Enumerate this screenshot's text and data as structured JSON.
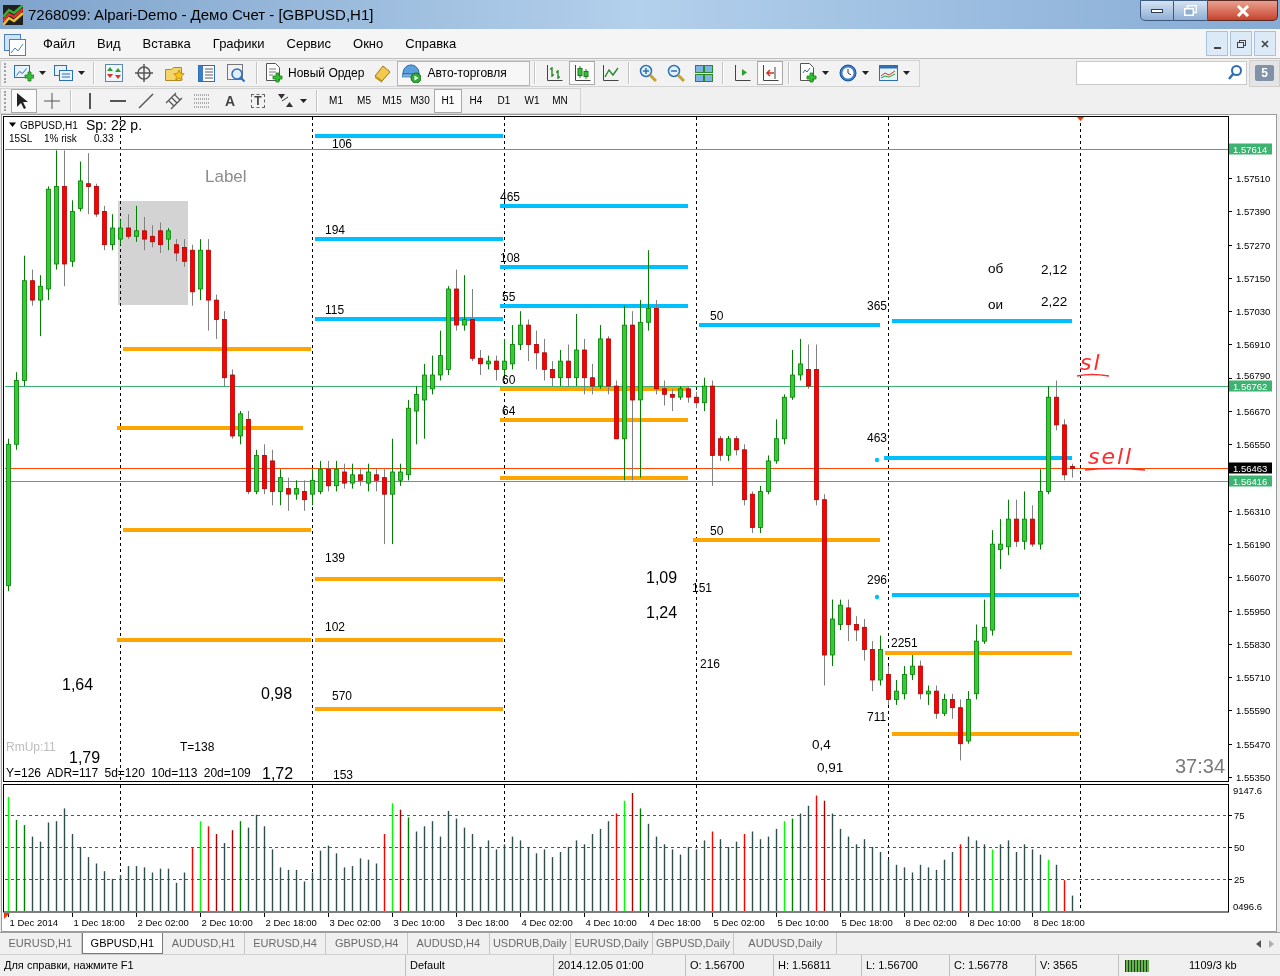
{
  "window": {
    "title": "7268099: Alpari-Demo - Демо Счет - [GBPUSD,H1]"
  },
  "menu": [
    "Файл",
    "Вид",
    "Вставка",
    "Графики",
    "Сервис",
    "Окно",
    "Справка"
  ],
  "toolbar": {
    "new_order": "Новый Ордер",
    "auto_trading": {
      "label": "Авто-торговля",
      "on": true
    },
    "chart_types": [
      {
        "selected": false
      },
      {
        "selected": true
      },
      {
        "selected": false
      }
    ],
    "view_toggles": [
      {
        "selected": false
      },
      {
        "selected": true
      }
    ],
    "notifications": "5"
  },
  "drawing_toolbar": {
    "tools": [
      {
        "selected": true
      },
      {
        "selected": false
      },
      {
        "selected": false
      },
      {
        "selected": false
      },
      {
        "selected": false
      },
      {
        "selected": false
      },
      {
        "selected": false
      },
      {
        "glyph": "A",
        "selected": false
      },
      {
        "glyph": "T",
        "selected": false
      },
      {
        "selected": false
      }
    ],
    "periods": [
      {
        "label": "M1",
        "selected": false
      },
      {
        "label": "M5",
        "selected": false
      },
      {
        "label": "M15",
        "selected": false
      },
      {
        "label": "M30",
        "selected": false
      },
      {
        "label": "H1",
        "selected": true
      },
      {
        "label": "H4",
        "selected": false
      },
      {
        "label": "D1",
        "selected": false
      },
      {
        "label": "W1",
        "selected": false
      },
      {
        "label": "MN",
        "selected": false
      }
    ]
  },
  "chart": {
    "symbol": "GBPUSD,H1",
    "spread": "Sp: 22 p.",
    "stop_loss": "15SL",
    "risk": "1% risk",
    "lot": "0.33",
    "chart_data": [
      {
        "type": "candlestick",
        "categories": [
          null,
          null,
          null,
          null,
          null,
          null,
          null,
          null,
          null,
          null,
          null,
          null,
          null,
          null,
          null,
          null,
          null,
          null,
          null,
          null,
          null,
          null,
          null,
          null,
          null,
          null,
          null,
          null,
          null,
          null,
          null,
          null,
          null,
          null,
          null,
          null,
          null,
          null,
          null,
          null,
          null,
          null,
          null,
          null,
          null,
          null,
          null,
          null,
          null,
          null,
          null,
          null,
          null,
          null,
          null,
          null,
          null,
          null,
          null,
          null,
          null,
          null,
          null,
          null,
          null,
          null,
          null,
          null,
          null,
          null,
          null,
          null,
          null,
          null,
          null,
          null,
          null,
          null,
          null,
          null,
          null,
          null,
          null,
          null,
          null,
          null,
          null,
          null,
          null,
          null,
          null,
          null,
          null,
          null,
          null,
          null,
          null,
          null,
          null,
          null,
          null,
          null,
          null,
          null,
          null,
          null,
          null,
          null,
          null,
          null,
          null,
          null,
          null,
          null,
          null,
          null,
          null,
          null,
          null,
          null,
          null,
          null,
          null,
          null,
          null,
          null,
          null,
          null,
          null,
          null,
          null,
          null,
          null,
          null,
          null,
          null,
          null,
          null,
          null,
          null,
          null,
          null,
          null,
          null,
          null,
          null,
          null,
          null,
          null,
          null,
          null,
          null,
          null
        ],
        "ohlc": [
          [
            1.5604,
            1.5657,
            1.5602,
            1.5655
          ],
          [
            1.5655,
            1.5681,
            1.5653,
            1.5678
          ],
          [
            1.5678,
            1.5723,
            1.5676,
            1.5714
          ],
          [
            1.5714,
            1.5718,
            1.5705,
            1.5707
          ],
          [
            1.5707,
            1.5716,
            1.5694,
            1.5712
          ],
          [
            1.5711,
            1.5748,
            1.5707,
            1.5747
          ],
          [
            1.572,
            1.5761,
            1.5718,
            1.5748
          ],
          [
            1.5748,
            1.5761,
            1.5712,
            1.572
          ],
          [
            1.5721,
            1.5743,
            1.5719,
            1.5739
          ],
          [
            1.574,
            1.5757,
            1.5739,
            1.575
          ],
          [
            1.5749,
            1.576,
            1.5738,
            1.5748
          ],
          [
            1.5748,
            1.5749,
            1.5737,
            1.5738
          ],
          [
            1.5739,
            1.5741,
            1.5725,
            1.5727
          ],
          [
            1.5727,
            1.5738,
            1.5725,
            1.5733
          ],
          [
            1.5729,
            1.5736,
            1.5727,
            1.5733
          ],
          [
            1.5733,
            1.5738,
            1.5729,
            1.573
          ],
          [
            1.573,
            1.5741,
            1.5728,
            1.5732
          ],
          [
            1.5732,
            1.5737,
            1.5725,
            1.5729
          ],
          [
            1.573,
            1.5734,
            1.5726,
            1.5728
          ],
          [
            1.5732,
            1.5735,
            1.5724,
            1.5727
          ],
          [
            1.5729,
            1.5733,
            1.5725,
            1.5732
          ],
          [
            1.5727,
            1.5729,
            1.5721,
            1.5724
          ],
          [
            1.5726,
            1.5729,
            1.5719,
            1.5721
          ],
          [
            1.5725,
            1.5727,
            1.5705,
            1.571
          ],
          [
            1.5711,
            1.5729,
            1.5707,
            1.5725
          ],
          [
            1.5725,
            1.5729,
            1.5696,
            1.5707
          ],
          [
            1.5707,
            1.5709,
            1.5693,
            1.57
          ],
          [
            1.57,
            1.5703,
            1.5676,
            1.5679
          ],
          [
            1.568,
            1.5682,
            1.5657,
            1.5658
          ],
          [
            1.5658,
            1.5667,
            1.5655,
            1.5666
          ],
          [
            1.5664,
            1.5667,
            1.5637,
            1.5638
          ],
          [
            1.5638,
            1.5653,
            1.5637,
            1.5651
          ],
          [
            1.5651,
            1.5655,
            1.5637,
            1.5639
          ],
          [
            1.5649,
            1.5653,
            1.5633,
            1.5638
          ],
          [
            1.5638,
            1.5646,
            1.5633,
            1.5643
          ],
          [
            1.5639,
            1.5643,
            1.5631,
            1.5637
          ],
          [
            1.5637,
            1.5642,
            1.5635,
            1.5639
          ],
          [
            1.5638,
            1.5642,
            1.5631,
            1.5635
          ],
          [
            1.5637,
            1.5646,
            1.5633,
            1.5642
          ],
          [
            1.5638,
            1.5649,
            1.5637,
            1.5646
          ],
          [
            1.5646,
            1.5649,
            1.5638,
            1.564
          ],
          [
            1.564,
            1.5649,
            1.5638,
            1.5646
          ],
          [
            1.5645,
            1.5648,
            1.5639,
            1.5641
          ],
          [
            1.5641,
            1.5648,
            1.5639,
            1.5644
          ],
          [
            1.5644,
            1.5646,
            1.564,
            1.5642
          ],
          [
            1.5641,
            1.5648,
            1.5638,
            1.5645
          ],
          [
            1.5644,
            1.5646,
            1.5638,
            1.5642
          ],
          [
            1.5643,
            1.5646,
            1.5619,
            1.5637
          ],
          [
            1.5637,
            1.5657,
            1.5619,
            1.5645
          ],
          [
            1.5642,
            1.5648,
            1.564,
            1.5645
          ],
          [
            1.5644,
            1.5671,
            1.5642,
            1.5668
          ],
          [
            1.5667,
            1.5676,
            1.5655,
            1.5673
          ],
          [
            1.5671,
            1.5684,
            1.5657,
            1.568
          ],
          [
            1.5675,
            1.5687,
            1.5673,
            1.568
          ],
          [
            1.568,
            1.5696,
            1.5678,
            1.5687
          ],
          [
            1.5682,
            1.5712,
            1.568,
            1.5711
          ],
          [
            1.5711,
            1.5718,
            1.5696,
            1.5698
          ],
          [
            1.5698,
            1.5716,
            1.5696,
            1.57
          ],
          [
            1.57,
            1.5711,
            1.5685,
            1.5686
          ],
          [
            1.5686,
            1.5689,
            1.568,
            1.5684
          ],
          [
            1.5684,
            1.5687,
            1.5682,
            1.5685
          ],
          [
            1.5685,
            1.5687,
            1.5678,
            1.5682
          ],
          [
            1.5682,
            1.5693,
            1.568,
            1.5685
          ],
          [
            1.5684,
            1.5698,
            1.5682,
            1.5691
          ],
          [
            1.5691,
            1.5703,
            1.5689,
            1.5698
          ],
          [
            1.5698,
            1.57,
            1.5685,
            1.5691
          ],
          [
            1.5691,
            1.5696,
            1.5682,
            1.5688
          ],
          [
            1.5688,
            1.5693,
            1.5678,
            1.5682
          ],
          [
            1.5682,
            1.5685,
            1.5676,
            1.5679
          ],
          [
            1.5679,
            1.5689,
            1.5676,
            1.5685
          ],
          [
            1.5685,
            1.5691,
            1.5676,
            1.5679
          ],
          [
            1.5679,
            1.5702,
            1.5676,
            1.5689
          ],
          [
            1.5689,
            1.5693,
            1.5673,
            1.5679
          ],
          [
            1.5679,
            1.5684,
            1.5673,
            1.5676
          ],
          [
            1.5676,
            1.5698,
            1.5675,
            1.5693
          ],
          [
            1.5693,
            1.5694,
            1.5673,
            1.5676
          ],
          [
            1.5676,
            1.5678,
            1.5657,
            1.5657
          ],
          [
            1.5657,
            1.5705,
            1.5642,
            1.5698
          ],
          [
            1.5698,
            1.5703,
            1.5642,
            1.5671
          ],
          [
            1.5671,
            1.5707,
            1.5643,
            1.5699
          ],
          [
            1.5699,
            1.5725,
            1.5696,
            1.5704
          ],
          [
            1.5704,
            1.5707,
            1.5673,
            1.5675
          ],
          [
            1.5675,
            1.5678,
            1.5669,
            1.5673
          ],
          [
            1.5673,
            1.5675,
            1.5667,
            1.5672
          ],
          [
            1.5672,
            1.5676,
            1.5671,
            1.5675
          ],
          [
            1.5675,
            1.5676,
            1.567,
            1.5672
          ],
          [
            1.5672,
            1.5674,
            1.5668,
            1.567
          ],
          [
            1.567,
            1.5679,
            1.5667,
            1.5676
          ],
          [
            1.5676,
            1.5678,
            1.564,
            1.5651
          ],
          [
            1.5657,
            1.5658,
            1.5649,
            1.5651
          ],
          [
            1.5651,
            1.5658,
            1.5649,
            1.5657
          ],
          [
            1.5657,
            1.5658,
            1.5651,
            1.5653
          ],
          [
            1.5653,
            1.5655,
            1.5633,
            1.5635
          ],
          [
            1.5637,
            1.5638,
            1.5623,
            1.5625
          ],
          [
            1.5625,
            1.564,
            1.5623,
            1.5638
          ],
          [
            1.5638,
            1.5651,
            1.5637,
            1.5649
          ],
          [
            1.5649,
            1.5664,
            1.5648,
            1.5657
          ],
          [
            1.5657,
            1.5673,
            1.5655,
            1.5672
          ],
          [
            1.5672,
            1.5689,
            1.5671,
            1.568
          ],
          [
            1.568,
            1.5693,
            1.5678,
            1.5684
          ],
          [
            1.5682,
            1.5691,
            1.5675,
            1.5676
          ],
          [
            1.5682,
            1.5691,
            1.5633,
            1.5635
          ],
          [
            1.5635,
            1.5637,
            1.5568,
            1.5579
          ],
          [
            1.5579,
            1.5599,
            1.5575,
            1.5592
          ],
          [
            1.559,
            1.5599,
            1.5588,
            1.5597
          ],
          [
            1.5596,
            1.5599,
            1.5584,
            1.559
          ],
          [
            1.559,
            1.5593,
            1.5584,
            1.5588
          ],
          [
            1.5589,
            1.5592,
            1.5577,
            1.5581
          ],
          [
            1.5581,
            1.5584,
            1.5566,
            1.557
          ],
          [
            1.557,
            1.5586,
            1.5568,
            1.5581
          ],
          [
            1.5572,
            1.5575,
            1.5561,
            1.5563
          ],
          [
            1.5563,
            1.557,
            1.5561,
            1.5566
          ],
          [
            1.5565,
            1.5575,
            1.5563,
            1.5572
          ],
          [
            1.5572,
            1.5579,
            1.557,
            1.5575
          ],
          [
            1.5575,
            1.5577,
            1.5563,
            1.5565
          ],
          [
            1.5565,
            1.5568,
            1.5561,
            1.5566
          ],
          [
            1.5566,
            1.5568,
            1.5556,
            1.5558
          ],
          [
            1.5558,
            1.5565,
            1.5557,
            1.5563
          ],
          [
            1.5563,
            1.5565,
            1.5556,
            1.556
          ],
          [
            1.556,
            1.5563,
            1.5541,
            1.5547
          ],
          [
            1.5548,
            1.5566,
            1.5547,
            1.5563
          ],
          [
            1.5565,
            1.559,
            1.5563,
            1.5584
          ],
          [
            1.5584,
            1.5599,
            1.5583,
            1.5589
          ],
          [
            1.5588,
            1.5624,
            1.5586,
            1.5619
          ],
          [
            1.5617,
            1.5628,
            1.561,
            1.5619
          ],
          [
            1.5618,
            1.5635,
            1.5615,
            1.5628
          ],
          [
            1.5628,
            1.5635,
            1.5618,
            1.562
          ],
          [
            1.562,
            1.5638,
            1.5617,
            1.5628
          ],
          [
            1.5628,
            1.5633,
            1.5618,
            1.5619
          ],
          [
            1.5619,
            1.5646,
            1.5617,
            1.5638
          ],
          [
            1.5638,
            1.5676,
            1.5637,
            1.5672
          ],
          [
            1.5672,
            1.5678,
            1.566,
            1.5662
          ],
          [
            1.5662,
            1.5664,
            1.5642,
            1.5644
          ],
          [
            1.5647,
            1.5648,
            1.5643,
            1.56463
          ],
          null,
          null,
          null,
          null,
          null,
          null,
          null,
          null,
          null,
          null,
          null,
          null,
          null,
          null,
          null,
          null,
          null,
          null,
          null
        ],
        "ylim": [
          1.55332,
          1.57734
        ],
        "yticks": [
          {
            "value": 1.5535,
            "label": "1.55350"
          },
          {
            "value": 1.5547,
            "label": "1.55470"
          },
          {
            "value": 1.5559,
            "label": "1.55590"
          },
          {
            "value": 1.5571,
            "label": "1.55710"
          },
          {
            "value": 1.5583,
            "label": "1.55830"
          },
          {
            "value": 1.5595,
            "label": "1.55950"
          },
          {
            "value": 1.5607,
            "label": "1.56070"
          },
          {
            "value": 1.5619,
            "label": "1.56190"
          },
          {
            "value": 1.5631,
            "label": "1.56310"
          },
          {
            "value": 1.5655,
            "label": "1.56550"
          },
          {
            "value": 1.5667,
            "label": "1.56670"
          },
          {
            "value": 1.5679,
            "label": "1.56790"
          },
          {
            "value": 1.5691,
            "label": "1.56910"
          },
          {
            "value": 1.5703,
            "label": "1.57030"
          },
          {
            "value": 1.5715,
            "label": "1.57150"
          },
          {
            "value": 1.5727,
            "label": "1.57270"
          },
          {
            "value": 1.5739,
            "label": "1.57390"
          },
          {
            "value": 1.5751,
            "label": "1.57510"
          }
        ],
        "ref_lines": [
          {
            "axis": "y",
            "value": 1.57614,
            "label": "1.57614",
            "color": "#3cb371"
          },
          {
            "axis": "y",
            "value": 1.56762,
            "label": "1.56762",
            "color": "#3cb371"
          },
          {
            "axis": "y",
            "value": 1.56463,
            "label": "1.56463",
            "color": "#ff4500"
          },
          {
            "axis": "y",
            "value": 1.56416,
            "label": "1.56416",
            "color": "#3cb371"
          }
        ]
      },
      {
        "type": "bar",
        "values": [
          89,
          71,
          67,
          58,
          54,
          69,
          70,
          80,
          60,
          50,
          42,
          37,
          31,
          25,
          28,
          35,
          35,
          34,
          30,
          33,
          33,
          22,
          30,
          49,
          70,
          66,
          60,
          53,
          63,
          70,
          65,
          75,
          66,
          48,
          34,
          32,
          32,
          23,
          30,
          47,
          51,
          45,
          34,
          35,
          41,
          40,
          37,
          60,
          84,
          79,
          73,
          62,
          66,
          70,
          58,
          78,
          72,
          65,
          60,
          50,
          55,
          48,
          52,
          58,
          55,
          50,
          45,
          48,
          42,
          46,
          50,
          55,
          52,
          60,
          64,
          70,
          76,
          86,
          92,
          80,
          68,
          58,
          52,
          48,
          44,
          50,
          48,
          55,
          62,
          56,
          50,
          54,
          60,
          62,
          56,
          58,
          64,
          70,
          72,
          76,
          82,
          90,
          86,
          76,
          64,
          58,
          52,
          56,
          50,
          46,
          40,
          36,
          34,
          30,
          36,
          34,
          32,
          40,
          46,
          52,
          58,
          55,
          52,
          48,
          52,
          55,
          46,
          52,
          48,
          44,
          40,
          36,
          24,
          12,
          null,
          null,
          null,
          null,
          null,
          null,
          null,
          null,
          null,
          null,
          null,
          null,
          null,
          null,
          null,
          null,
          null,
          null,
          null
        ],
        "colors": [
          "#00ff00",
          "#008000",
          "#008000",
          "#2f4f4f",
          "#2f4f4f",
          "#2f4f4f",
          "#2f4f4f",
          "#2f4f4f",
          "#2f4f4f",
          "#2f4f4f",
          "#2f4f4f",
          "#2f4f4f",
          "#2f4f4f",
          "#2f4f4f",
          "#2f4f4f",
          "#2f4f4f",
          "#2f4f4f",
          "#2f4f4f",
          "#2f4f4f",
          "#2f4f4f",
          "#2f4f4f",
          "#2f4f4f",
          "#2f4f4f",
          "#ff0000",
          "#00ff00",
          "#ff0000",
          "#b00000",
          "#2f4f4f",
          "#b00000",
          "#008000",
          "#2f4f4f",
          "#2f4f4f",
          "#2f4f4f",
          "#2f4f4f",
          "#2f4f4f",
          "#2f4f4f",
          "#2f4f4f",
          "#2f4f4f",
          "#2f4f4f",
          "#2f4f4f",
          "#2f4f4f",
          "#2f4f4f",
          "#2f4f4f",
          "#2f4f4f",
          "#2f4f4f",
          "#2f4f4f",
          "#2f4f4f",
          "#ff0000",
          "#00ff00",
          "#b00000",
          "#008000",
          "#2f4f4f",
          "#2f4f4f",
          "#2f4f4f",
          "#2f4f4f",
          "#2f4f4f",
          "#2f4f4f",
          "#2f4f4f",
          "#2f4f4f",
          "#2f4f4f",
          "#2f4f4f",
          "#2f4f4f",
          "#2f4f4f",
          "#2f4f4f",
          "#2f4f4f",
          "#2f4f4f",
          "#2f4f4f",
          "#2f4f4f",
          "#2f4f4f",
          "#2f4f4f",
          "#2f4f4f",
          "#2f4f4f",
          "#2f4f4f",
          "#2f4f4f",
          "#2f4f4f",
          "#2f4f4f",
          "#ff0000",
          "#00ff00",
          "#b00000",
          "#008000",
          "#2f4f4f",
          "#2f4f4f",
          "#2f4f4f",
          "#2f4f4f",
          "#2f4f4f",
          "#2f4f4f",
          "#2f4f4f",
          "#2f4f4f",
          "#ff0000",
          "#2f4f4f",
          "#2f4f4f",
          "#2f4f4f",
          "#ff0000",
          "#2f4f4f",
          "#2f4f4f",
          "#2f4f4f",
          "#2f4f4f",
          "#00ff00",
          "#008000",
          "#2f4f4f",
          "#2f4f4f",
          "#ff0000",
          "#b00000",
          "#2f4f4f",
          "#2f4f4f",
          "#2f4f4f",
          "#2f4f4f",
          "#2f4f4f",
          "#2f4f4f",
          "#2f4f4f",
          "#2f4f4f",
          "#2f4f4f",
          "#2f4f4f",
          "#2f4f4f",
          "#2f4f4f",
          "#2f4f4f",
          "#2f4f4f",
          "#2f4f4f",
          "#2f4f4f",
          "#ff0000",
          "#2f4f4f",
          "#2f4f4f",
          "#2f4f4f",
          "#00ff00",
          "#2f4f4f",
          "#2f4f4f",
          "#2f4f4f",
          "#2f4f4f",
          "#2f4f4f",
          "#2f4f4f",
          "#00ff00",
          "#2f4f4f",
          "#ff0000",
          "#2f4f4f",
          null,
          null,
          null,
          null,
          null,
          null,
          null,
          null,
          null,
          null,
          null,
          null,
          null,
          null,
          null,
          null,
          null,
          null,
          null
        ],
        "ylim": [
          0,
          99
        ],
        "yticks": [
          25,
          50,
          75
        ],
        "grid": true
      }
    ],
    "time_axis": [
      "1 Dec 2014",
      "1 Dec 18:00",
      "2 Dec 02:00",
      "2 Dec 10:00",
      "2 Dec 18:00",
      "3 Dec 02:00",
      "3 Dec 10:00",
      "3 Dec 18:00",
      "4 Dec 02:00",
      "4 Dec 10:00",
      "4 Dec 18:00",
      "5 Dec 02:00",
      "5 Dec 10:00",
      "5 Dec 18:00",
      "8 Dec 02:00",
      "8 Dec 10:00",
      "8 Dec 18:00"
    ],
    "indicator_scale": [
      "9147.6",
      "0496.6"
    ],
    "texts": [
      {
        "text": "Label",
        "kind": "label"
      },
      {
        "text": "106",
        "kind": "level"
      },
      {
        "text": "465",
        "kind": "level"
      },
      {
        "text": "194",
        "kind": "level"
      },
      {
        "text": "108",
        "kind": "level"
      },
      {
        "text": "об",
        "kind": "note"
      },
      {
        "text": "2,12",
        "kind": "note"
      },
      {
        "text": "ои",
        "kind": "note"
      },
      {
        "text": "2,22",
        "kind": "note"
      },
      {
        "text": "55",
        "kind": "level"
      },
      {
        "text": "365",
        "kind": "level"
      },
      {
        "text": "115",
        "kind": "level"
      },
      {
        "text": "50",
        "kind": "level"
      },
      {
        "text": "sl",
        "kind": "handwritten"
      },
      {
        "text": "60",
        "kind": "level"
      },
      {
        "text": "64",
        "kind": "level"
      },
      {
        "text": "463",
        "kind": "level"
      },
      {
        "text": "sell",
        "kind": "handwritten"
      },
      {
        "text": "50",
        "kind": "level"
      },
      {
        "text": "139",
        "kind": "level"
      },
      {
        "text": "1,09",
        "kind": "ratio"
      },
      {
        "text": "296",
        "kind": "level"
      },
      {
        "text": "151",
        "kind": "level"
      },
      {
        "text": "1,24",
        "kind": "ratio"
      },
      {
        "text": "102",
        "kind": "level"
      },
      {
        "text": "2251",
        "kind": "level"
      },
      {
        "text": "216",
        "kind": "level"
      },
      {
        "text": "1,64",
        "kind": "ratio"
      },
      {
        "text": "0,98",
        "kind": "ratio"
      },
      {
        "text": "570",
        "kind": "level"
      },
      {
        "text": "711",
        "kind": "level"
      },
      {
        "text": "0,4",
        "kind": "note"
      },
      {
        "text": "1,79",
        "kind": "ratio"
      },
      {
        "text": "0,91",
        "kind": "note"
      },
      {
        "text": "1,72",
        "kind": "ratio"
      },
      {
        "text": "153",
        "kind": "level"
      }
    ],
    "info": {
      "rm_up": "RmUp:11",
      "t": "T=138",
      "ranges": "Y=126 ADR=117 5d=120 10d=113 20d=109"
    },
    "timer": "37:34"
  },
  "tabs": [
    {
      "label": "EURUSD,H1",
      "selected": false
    },
    {
      "label": "GBPUSD,H1",
      "selected": true
    },
    {
      "label": "AUDUSD,H1",
      "selected": false
    },
    {
      "label": "EURUSD,H4",
      "selected": false
    },
    {
      "label": "GBPUSD,H4",
      "selected": false
    },
    {
      "label": "AUDUSD,H4",
      "selected": false
    },
    {
      "label": "USDRUB,Daily",
      "selected": false
    },
    {
      "label": "EURUSD,Daily",
      "selected": false
    },
    {
      "label": "GBPUSD,Daily",
      "selected": false
    },
    {
      "label": "AUDUSD,Daily",
      "selected": false
    }
  ],
  "status_bar": {
    "help": "Для справки, нажмите F1",
    "profile": "Default",
    "time": "2014.12.05 01:00",
    "open": "O: 1.56700",
    "high": "H: 1.56811",
    "low": "L: 1.56700",
    "close": "C: 1.56778",
    "volume": "V: 3565",
    "traffic": "1109/3 kb"
  }
}
